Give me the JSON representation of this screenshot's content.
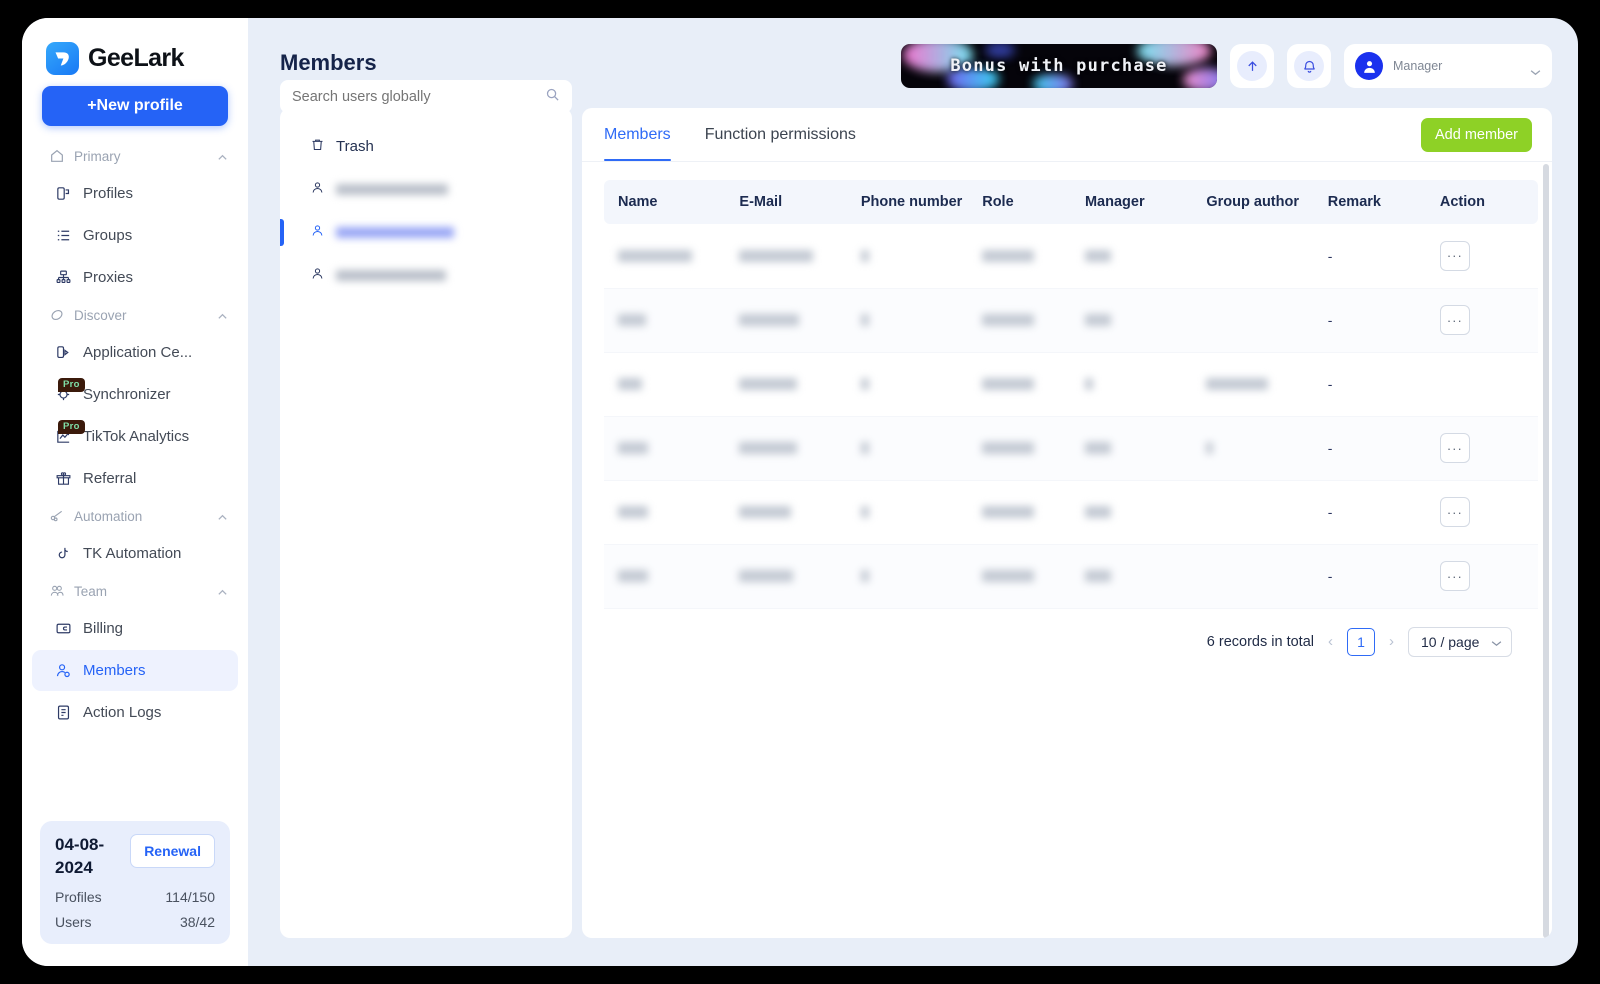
{
  "brand": {
    "name": "GeeLark",
    "new_profile_label": "+New profile"
  },
  "sidebar": {
    "groups": [
      {
        "label": "Primary",
        "icon": "home-icon",
        "items": [
          {
            "label": "Profiles",
            "icon": "profiles-icon"
          },
          {
            "label": "Groups",
            "icon": "groups-icon"
          },
          {
            "label": "Proxies",
            "icon": "proxies-icon"
          }
        ]
      },
      {
        "label": "Discover",
        "icon": "compass-icon",
        "items": [
          {
            "label": "Application Ce...",
            "icon": "application-center-icon"
          },
          {
            "label": "Synchronizer",
            "icon": "synchronizer-icon",
            "badge": "Pro"
          },
          {
            "label": "TikTok Analytics",
            "icon": "analytics-icon",
            "badge": "Pro"
          },
          {
            "label": "Referral",
            "icon": "gift-icon"
          }
        ]
      },
      {
        "label": "Automation",
        "icon": "automation-icon",
        "items": [
          {
            "label": "TK Automation",
            "icon": "tiktok-icon"
          }
        ]
      },
      {
        "label": "Team",
        "icon": "team-icon",
        "items": [
          {
            "label": "Billing",
            "icon": "billing-icon"
          },
          {
            "label": "Members",
            "icon": "members-icon",
            "active": true
          },
          {
            "label": "Action Logs",
            "icon": "action-logs-icon"
          }
        ]
      }
    ],
    "plan": {
      "date": "04-08-2024",
      "renewal_label": "Renewal",
      "rows": [
        {
          "label": "Profiles",
          "value": "114/150"
        },
        {
          "label": "Users",
          "value": "38/42"
        }
      ]
    }
  },
  "header": {
    "title": "Members",
    "search_placeholder": "Search users globally",
    "promo_banner_text": "Bonus with purchase",
    "upload_icon": "upload-arrow-icon",
    "bell_icon": "bell-icon",
    "user": {
      "name": "",
      "role": "Manager"
    }
  },
  "list_panel": {
    "trash_label": "Trash",
    "trash_icon": "trash-icon",
    "users": [
      {
        "name": "",
        "selected": false
      },
      {
        "name": "",
        "selected": true
      },
      {
        "name": "",
        "selected": false
      }
    ]
  },
  "tabs": [
    {
      "label": "Members",
      "active": true
    },
    {
      "label": "Function permissions",
      "active": false
    }
  ],
  "add_member_label": "Add member",
  "table": {
    "columns": [
      "Name",
      "E-Mail",
      "Phone number",
      "Role",
      "Manager",
      "Group author",
      "Remark",
      "Action"
    ],
    "rows": [
      {
        "name": "",
        "email": "",
        "phone": "",
        "role": "",
        "manager": "",
        "group_author": "",
        "remark": "-",
        "action": "···"
      },
      {
        "name": "",
        "email": "",
        "phone": "",
        "role": "",
        "manager": "",
        "group_author": "",
        "remark": "-",
        "action": "···"
      },
      {
        "name": "",
        "email": "",
        "phone": "",
        "role": "",
        "manager": "",
        "group_author": "",
        "remark": "-",
        "action": ""
      },
      {
        "name": "",
        "email": "",
        "phone": "",
        "role": "",
        "manager": "",
        "group_author": "",
        "remark": "-",
        "action": "···"
      },
      {
        "name": "",
        "email": "",
        "phone": "",
        "role": "",
        "manager": "",
        "group_author": "",
        "remark": "-",
        "action": "···"
      },
      {
        "name": "",
        "email": "",
        "phone": "",
        "role": "",
        "manager": "",
        "group_author": "",
        "remark": "-",
        "action": "···"
      }
    ]
  },
  "pagination": {
    "total_text": "6 records in total",
    "prev": "‹",
    "next": "›",
    "current_page": "1",
    "page_size": "10 / page"
  },
  "colors": {
    "primary_blue": "#2563f6",
    "accent_green": "#8ed126",
    "app_bg": "#e8eef8"
  }
}
